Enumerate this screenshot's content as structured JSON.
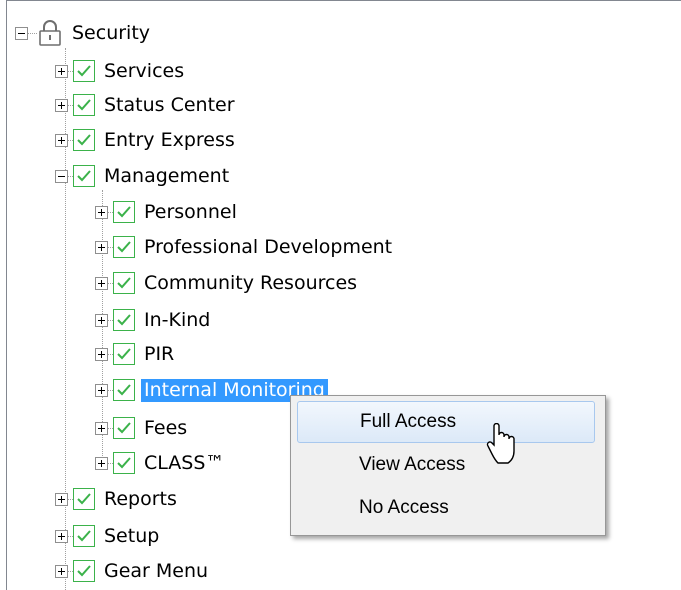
{
  "tree": {
    "root": {
      "label": "Security",
      "icon": "lock-icon"
    },
    "items": [
      {
        "label": "Services",
        "level": 1,
        "expanded": false
      },
      {
        "label": "Status Center",
        "level": 1,
        "expanded": false
      },
      {
        "label": "Entry Express",
        "level": 1,
        "expanded": false
      },
      {
        "label": "Management",
        "level": 1,
        "expanded": true
      },
      {
        "label": "Personnel",
        "level": 2,
        "expanded": false
      },
      {
        "label": "Professional Development",
        "level": 2,
        "expanded": false
      },
      {
        "label": "Community Resources",
        "level": 2,
        "expanded": false
      },
      {
        "label": "In-Kind",
        "level": 2,
        "expanded": false
      },
      {
        "label": "PIR",
        "level": 2,
        "expanded": false
      },
      {
        "label": "Internal Monitoring",
        "level": 2,
        "expanded": false,
        "selected": true
      },
      {
        "label": "Fees",
        "level": 2,
        "expanded": false
      },
      {
        "label": "CLASS™",
        "level": 2,
        "expanded": false
      },
      {
        "label": "Reports",
        "level": 1,
        "expanded": false
      },
      {
        "label": "Setup",
        "level": 1,
        "expanded": false
      },
      {
        "label": "Gear Menu",
        "level": 1,
        "expanded": false
      }
    ]
  },
  "context_menu": {
    "items": [
      {
        "label": "Full Access",
        "hovered": true
      },
      {
        "label": "View Access",
        "hovered": false
      },
      {
        "label": "No Access",
        "hovered": false
      }
    ]
  },
  "colors": {
    "selection": "#3399ff",
    "check": "#3bb24a",
    "menu_background": "#f0f0f0"
  }
}
